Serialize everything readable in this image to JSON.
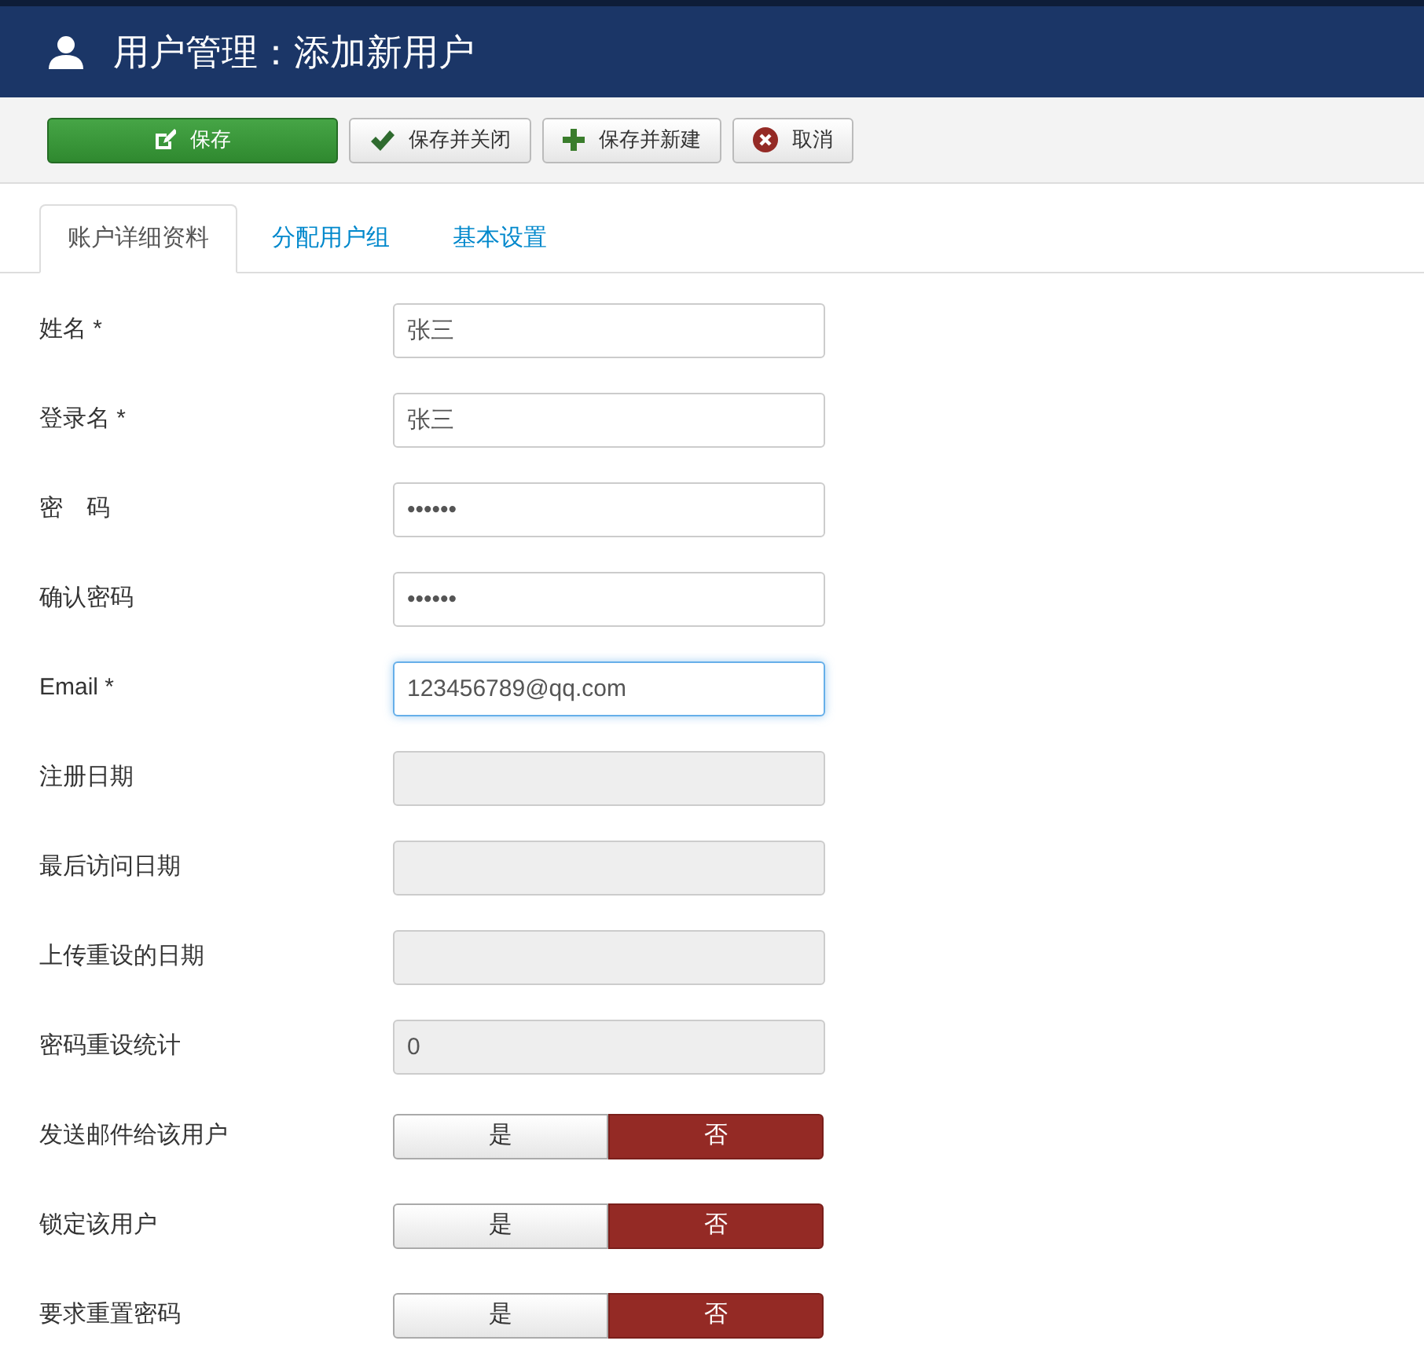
{
  "header": {
    "title": "用户管理：添加新用户"
  },
  "toolbar": [
    {
      "label": "保存",
      "kind": "primary"
    },
    {
      "label": "保存并关闭",
      "kind": "check"
    },
    {
      "label": "保存并新建",
      "kind": "plus"
    },
    {
      "label": "取消",
      "kind": "cancel"
    }
  ],
  "tabs": [
    {
      "label": "账户详细资料",
      "selected": true
    },
    {
      "label": "分配用户组",
      "selected": false
    },
    {
      "label": "基本设置",
      "selected": false
    }
  ],
  "fields": [
    {
      "label": "姓名 *",
      "kind": "text",
      "value": "张三",
      "focused": false
    },
    {
      "label": "登录名 *",
      "kind": "text",
      "value": "张三",
      "focused": false
    },
    {
      "label": "密　码",
      "kind": "text",
      "value": "••••••",
      "focused": false
    },
    {
      "label": "确认密码",
      "kind": "text",
      "value": "••••••",
      "focused": false
    },
    {
      "label": "Email *",
      "kind": "text",
      "value": "123456789@qq.com",
      "focused": true
    },
    {
      "label": "注册日期",
      "kind": "readonly"
    },
    {
      "label": "最后访问日期",
      "kind": "readonly"
    },
    {
      "label": "上传重设的日期",
      "kind": "readonly"
    },
    {
      "label": "密码重设统计",
      "kind": "readonly",
      "value": "0"
    },
    {
      "label": "发送邮件给该用户",
      "kind": "toggle",
      "options": [
        {
          "label": "是",
          "selected": false
        },
        {
          "label": "否",
          "selected": true
        }
      ]
    },
    {
      "label": "锁定该用户",
      "kind": "toggle",
      "options": [
        {
          "label": "是",
          "selected": false
        },
        {
          "label": "否",
          "selected": true
        }
      ]
    },
    {
      "label": "要求重置密码",
      "kind": "toggle",
      "options": [
        {
          "label": "是",
          "selected": false
        },
        {
          "label": "否",
          "selected": true
        }
      ]
    }
  ]
}
